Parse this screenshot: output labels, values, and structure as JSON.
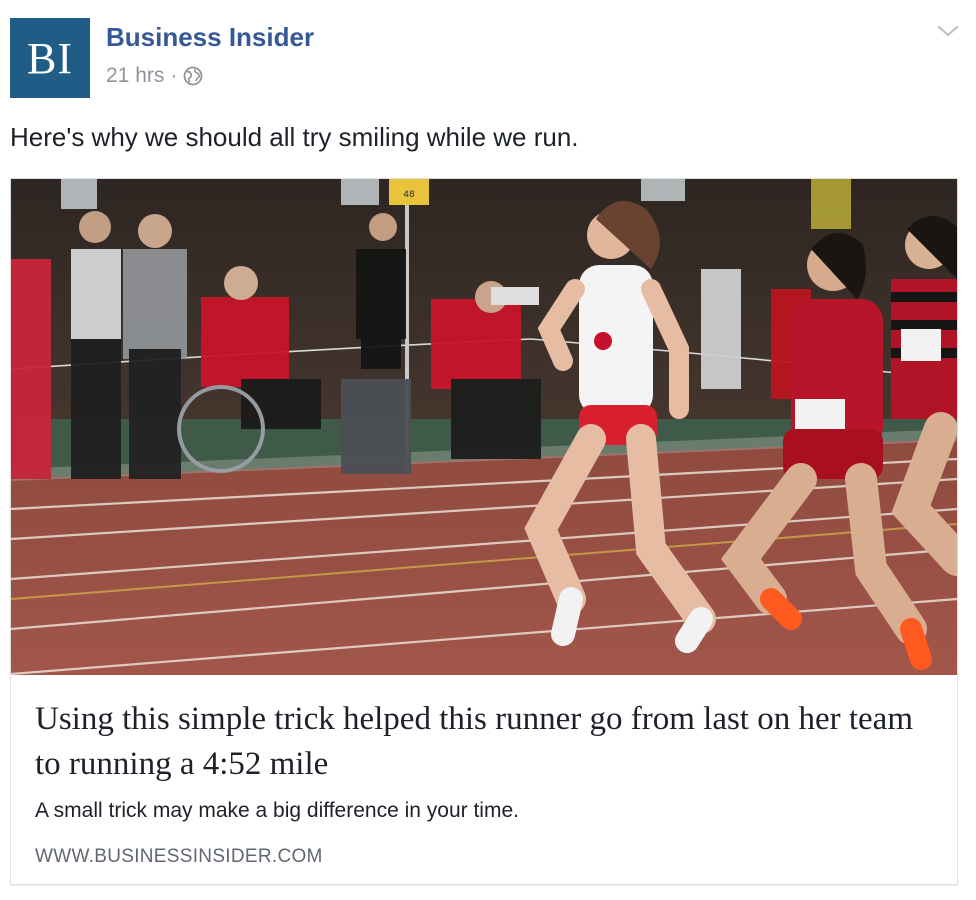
{
  "post": {
    "avatar_text": "BI",
    "page_name": "Business Insider",
    "timestamp": "21 hrs",
    "separator": "·",
    "privacy_icon": "globe-icon",
    "menu_icon": "chevron-down-icon",
    "caption": "Here's why we should all try smiling while we run."
  },
  "link_card": {
    "image_alt": "Women runners racing on an indoor red track with spectators behind a rope",
    "image_text": {
      "scoreboard": "48"
    },
    "headline": "Using this simple trick helped this runner go from last on her team to running a 4:52 mile",
    "description": "A small trick may make a big difference in your time.",
    "domain": "WWW.BUSINESSINSIDER.COM"
  },
  "colors": {
    "brand_avatar": "#1f5d86",
    "page_name": "#365899",
    "meta_text": "#90949c",
    "track": "#9a4a40",
    "jersey_red": "#c8102e"
  }
}
